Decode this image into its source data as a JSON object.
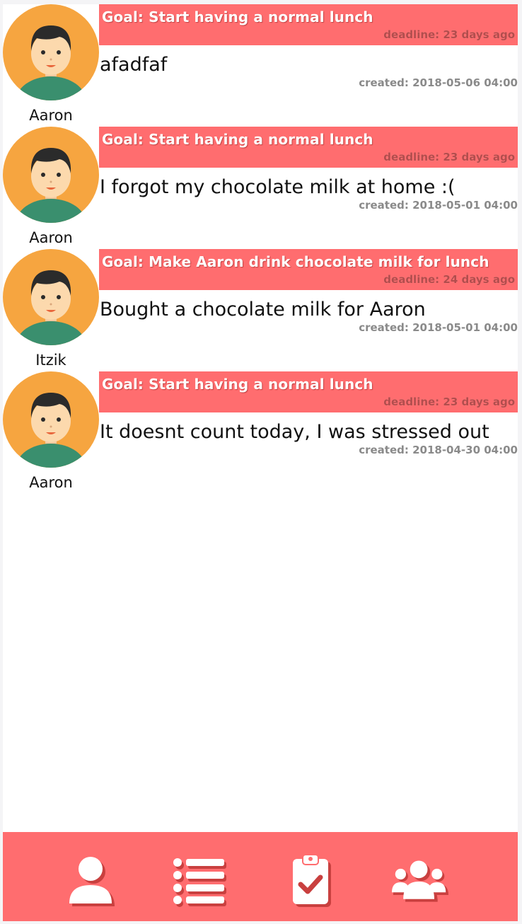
{
  "colors": {
    "accent": "#ff6d6f",
    "accent_dark": "#c9403f",
    "avatar_bg": "#f6a540",
    "shirt": "#3a8f6e"
  },
  "posts": [
    {
      "user": "Aaron",
      "goal": "Goal: Start having a normal lunch",
      "deadline": "deadline: 23 days ago",
      "text": "afadfaf",
      "created": "created: 2018-05-06 04:00"
    },
    {
      "user": "Aaron",
      "goal": "Goal: Start having a normal lunch",
      "deadline": "deadline: 23 days ago",
      "text": "I forgot my chocolate milk at home :(",
      "created": "created: 2018-05-01 04:00"
    },
    {
      "user": "Itzik",
      "goal": "Goal: Make Aaron drink chocolate milk for lunch",
      "deadline": "deadline: 24 days ago",
      "text": "Bought a chocolate milk for Aaron",
      "created": "created: 2018-05-01 04:00"
    },
    {
      "user": "Aaron",
      "goal": "Goal: Start having a normal lunch",
      "deadline": "deadline: 23 days ago",
      "text": "It doesnt count today, I was stressed out",
      "created": "created: 2018-04-30 04:00"
    }
  ],
  "nav": {
    "items": [
      {
        "icon": "profile-icon"
      },
      {
        "icon": "list-icon"
      },
      {
        "icon": "clipboard-check-icon"
      },
      {
        "icon": "group-icon"
      }
    ]
  }
}
